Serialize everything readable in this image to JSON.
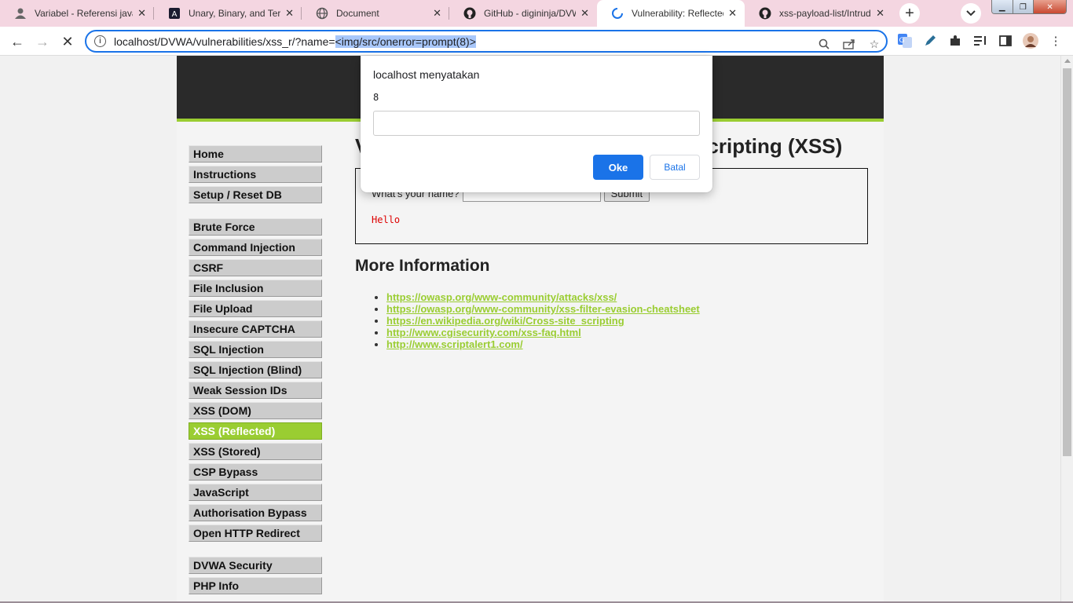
{
  "browser": {
    "tabs": [
      {
        "title": "Variabel - Referensi java",
        "icon": "person-icon"
      },
      {
        "title": "Unary, Binary, and Tern",
        "icon": "angular-icon"
      },
      {
        "title": "Document",
        "icon": "globe-icon"
      },
      {
        "title": "GitHub - digininja/DVW",
        "icon": "github-icon"
      },
      {
        "title": "Vulnerability: Reflected",
        "icon": "loading-spinner-icon"
      },
      {
        "title": "xss-payload-list/Intrude",
        "icon": "github-icon"
      }
    ],
    "url_prefix": "localhost/DVWA/vulnerabilities/xss_r/?name=",
    "url_selected": "<img/src/onerror=prompt(8)>"
  },
  "dialog": {
    "origin": "localhost menyatakan",
    "message": "8",
    "input_value": "",
    "ok_label": "Oke",
    "cancel_label": "Batal"
  },
  "sidebar": {
    "group1": [
      "Home",
      "Instructions",
      "Setup / Reset DB"
    ],
    "group2": [
      "Brute Force",
      "Command Injection",
      "CSRF",
      "File Inclusion",
      "File Upload",
      "Insecure CAPTCHA",
      "SQL Injection",
      "SQL Injection (Blind)",
      "Weak Session IDs",
      "XSS (DOM)",
      "XSS (Reflected)",
      "XSS (Stored)",
      "CSP Bypass",
      "JavaScript",
      "Authorisation Bypass",
      "Open HTTP Redirect"
    ],
    "group3": [
      "DVWA Security",
      "PHP Info"
    ],
    "selected": "XSS (Reflected)"
  },
  "main": {
    "title": "Vulnerability: Reflected Cross Site Scripting (XSS)",
    "form_label": "What's your name?",
    "submit_label": "Submit",
    "output": "Hello",
    "more_info_heading": "More Information",
    "links": [
      "https://owasp.org/www-community/attacks/xss/",
      "https://owasp.org/www-community/xss-filter-evasion-cheatsheet",
      "https://en.wikipedia.org/wiki/Cross-site_scripting",
      "http://www.cgisecurity.com/xss-faq.html",
      "http://www.scriptalert1.com/"
    ]
  },
  "colors": {
    "accent_green": "#9acd32",
    "chrome_blue": "#1a73e8",
    "tabstrip_pink": "#f4d6e1"
  }
}
